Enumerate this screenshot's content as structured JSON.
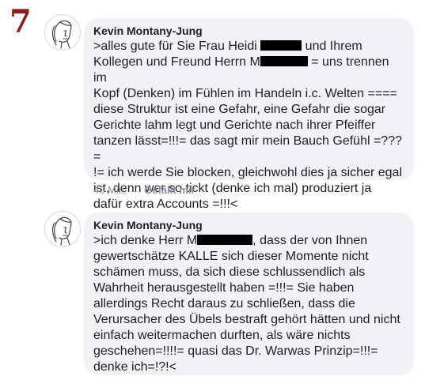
{
  "marker": {
    "number": "7"
  },
  "comments": [
    {
      "author": "Kevin Montany-Jung",
      "text": {
        "p1": ">alles gute für Sie Frau Heidi ",
        "p2": " und Ihrem\nKollegen und Freund Herrn M",
        "p3": " = uns trennen im\nKopf (Denken) im Fühlen im Handeln i.c. Welten ====\ndiese Struktur ist eine Gefahr, eine Gefahr die sogar\nGerichte lahm legt und Gerichte nach ihrer Pfeiffer\ntanzen lässt=!!!= das sagt mir mein Bauch Gefühl =???=\n!= ich werde Sie blocken, gleichwohl dies ja sicher egal\nist, denn wer so tickt (denke ich mal)  produziert ja\ndafür extra Accounts =!!!<"
      },
      "timestamp": "46 Min.",
      "like_label": "Gefällt mir"
    },
    {
      "author": "Kevin Montany-Jung",
      "text": {
        "p1": ">ich denke Herr M",
        "p2": ", dass der von Ihnen\ngewertschätze KALLE sich dieser Momente nicht\nschämen muss, da sich diese schlussendlich als\nWahrheit herausgestellt haben =!!!= Sie haben\nallerdings Recht daraus zu schließen, dass die\nVerursacher des Übels bestraft gehört hätten und nicht\neinfach weitermachen durften, als wäre nichts\ngeschehen=!!!!= quasi das Dr. Warwas Prinzip=!!!=\ndenke ich=!?!<"
      }
    }
  ]
}
